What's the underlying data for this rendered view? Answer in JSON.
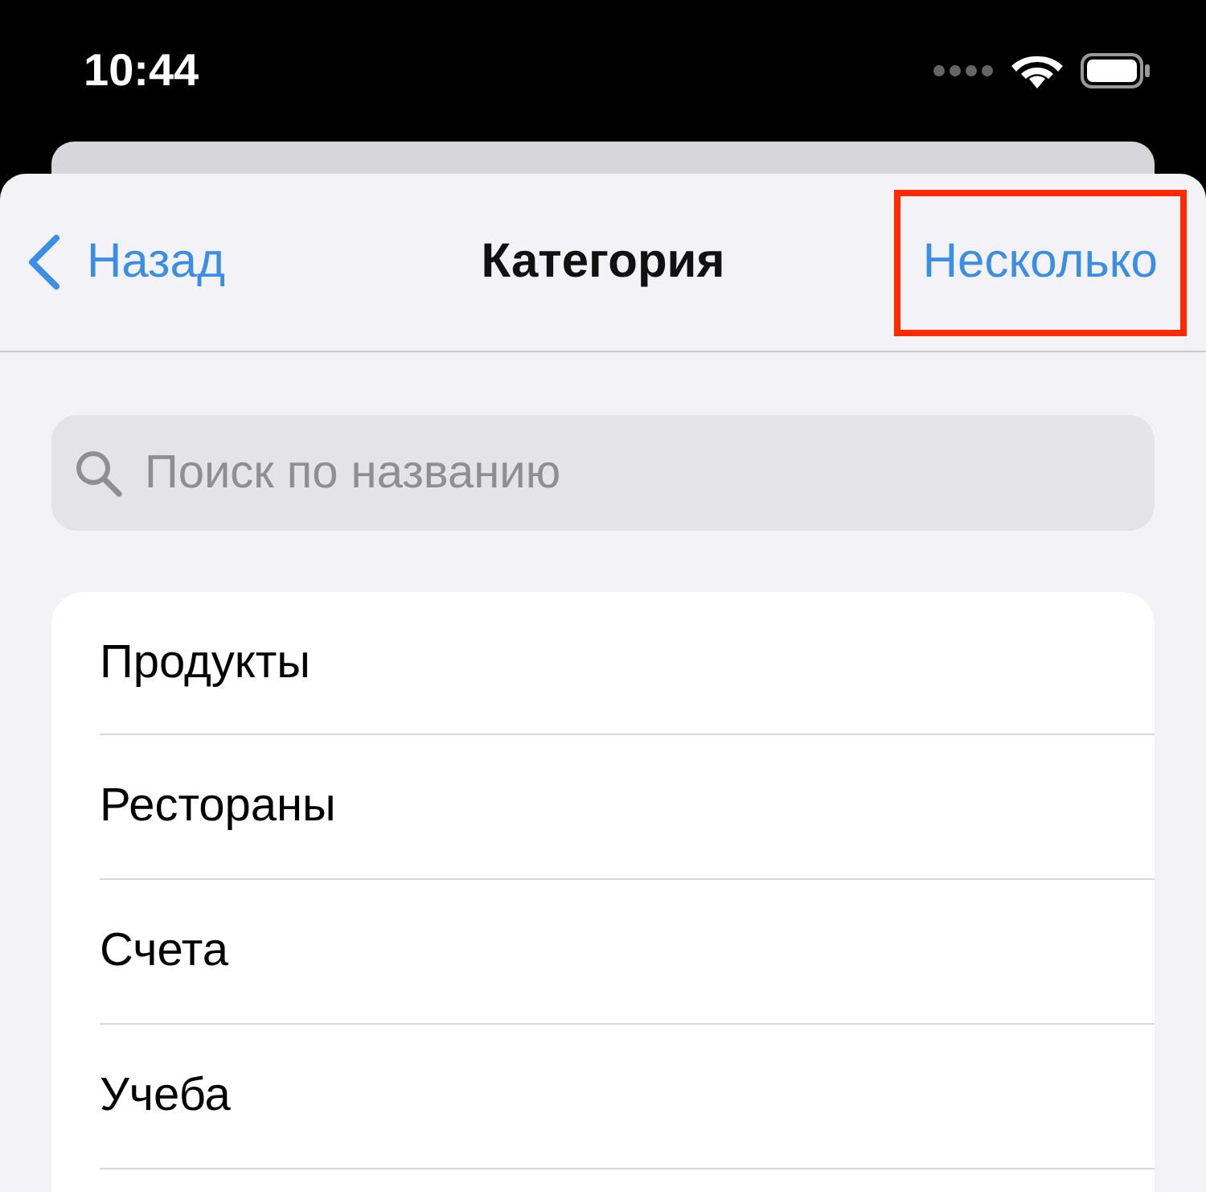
{
  "status_bar": {
    "time": "10:44"
  },
  "nav": {
    "back": "Назад",
    "title": "Категория",
    "action": {
      "label": "Несколько",
      "highlighted": true
    }
  },
  "search": {
    "placeholder": "Поиск по названию"
  },
  "categories": [
    {
      "label": "Продукты"
    },
    {
      "label": "Рестораны"
    },
    {
      "label": "Счета"
    },
    {
      "label": "Учеба"
    }
  ]
}
